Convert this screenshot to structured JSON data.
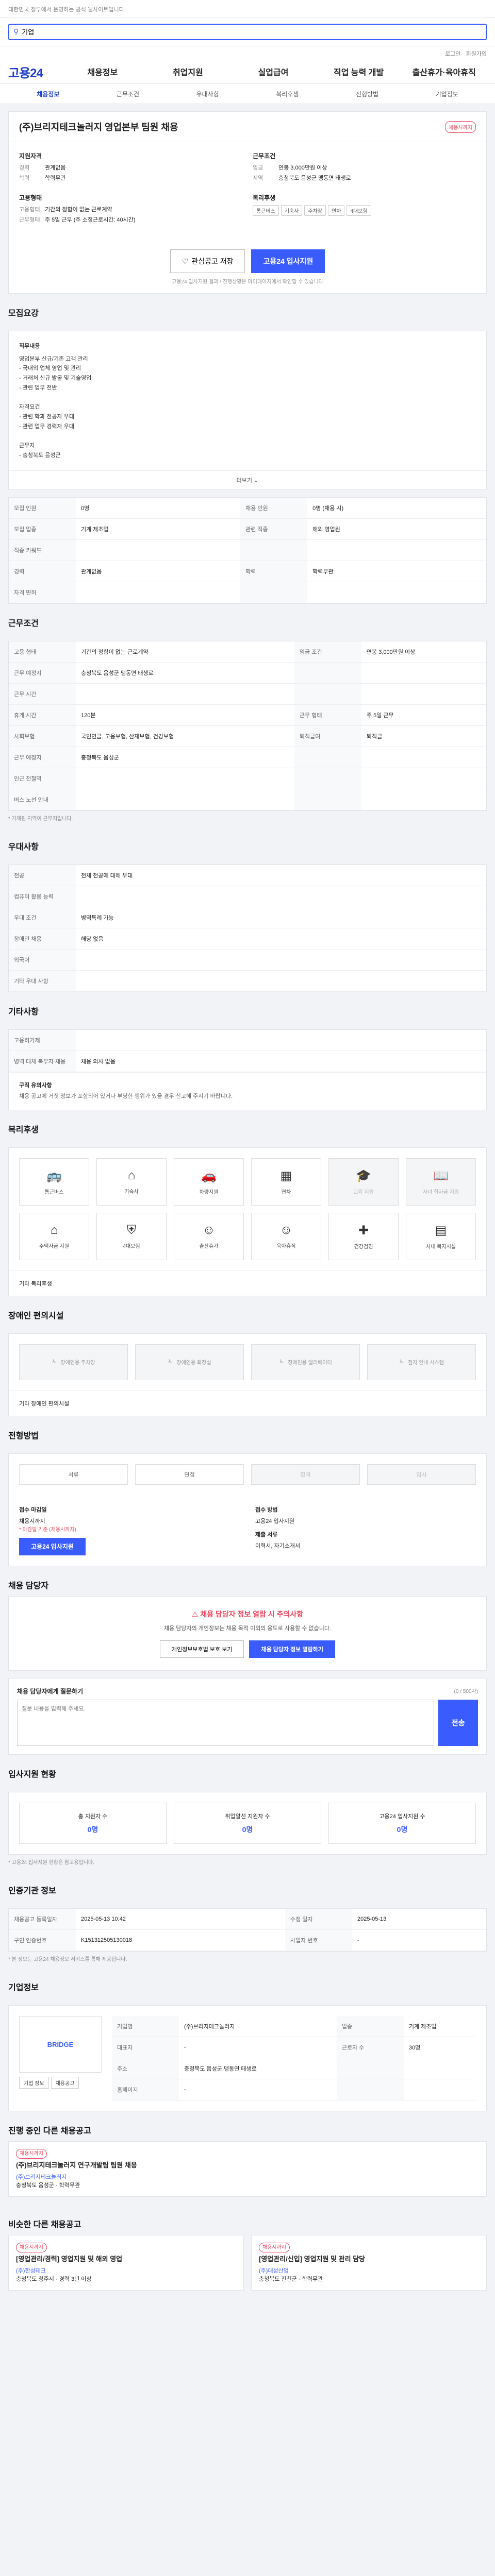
{
  "topbar": {
    "notice": "대한민국 정부에서 운영하는 공식 웹사이트입니다"
  },
  "search": {
    "value": "기업",
    "placeholder": ""
  },
  "header": {
    "logo": "고용24",
    "links": [
      "로그인",
      "회원가입"
    ],
    "gnb": [
      "채용정보",
      "취업지원",
      "실업급여",
      "직업 능력 개발",
      "출산휴가·육아휴직"
    ]
  },
  "lnb": {
    "items": [
      "채용정보",
      "근무조건",
      "우대사항",
      "복리후생",
      "전형방법",
      "기업정보"
    ]
  },
  "job": {
    "title": "(주)브리지테크놀러지 영업본부 팀원 채용",
    "badge": "채용시까지",
    "recruit_label": "지원자격",
    "career_k": "경력",
    "career_v": "관계없음",
    "edu_k": "학력",
    "edu_v": "학력무관",
    "condition_label": "근무조건",
    "salary_k": "임금",
    "salary_v": "연봉 3,000만원 이상",
    "region_k": "지역",
    "region_v": "충청북도 음성군 맹동면 태생로",
    "emp_label": "고용형태",
    "emptype_k": "고용형태",
    "emptype_v": "기간의 정함이 없는 근로계약",
    "worktime_k": "근무형태",
    "worktime_v": "주 5일 근무 (주 소정근로시간: 40시간)",
    "welfare_label": "복리후생",
    "welfare_chips": [
      "통근버스",
      "기숙사",
      "주차장",
      "연차",
      "4대보험"
    ],
    "scrap_label": "관심공고 저장",
    "apply_label": "고용24 입사지원",
    "notice": "고용24 입사지원 결과 / 진행상황은 마이페이지에서 확인할 수 있습니다"
  },
  "sections": {
    "recruit": "모집요강",
    "condition": "근무조건",
    "preference": "우대사항",
    "other": "기타사항",
    "welfare": "복리후생",
    "disabled": "장애인 편의시설",
    "process": "전형방법",
    "manager": "채용 담당자",
    "status": "입사지원 현황",
    "info": "인증기관 정보",
    "company": "기업정보",
    "related": "진행 중인 다른 채용공고",
    "similar": "비슷한 다른 채용공고"
  },
  "recruit": {
    "body_title": "직무내용",
    "lines": [
      "영업본부 신규/기존 고객 관리",
      "- 국내외 업체 영업 및 관리",
      "- 거래처 신규 발굴 및 기술영업",
      "- 관련 업무 전반",
      "",
      "자격요건",
      "- 관련 학과 전공자 우대",
      "- 관련 업무 경력자 우대",
      "",
      "근무지",
      "- 충청북도 음성군"
    ],
    "more": "더보기",
    "rows": [
      [
        "모집 인원",
        "0명",
        "채용 인원",
        "0명 (채용 시)"
      ],
      [
        "모집 업종",
        "기계 제조업",
        "관련 직종",
        "해외 영업원"
      ],
      [
        "직종 키워드",
        "",
        "",
        ""
      ],
      [
        "경력",
        "관계없음",
        "학력",
        "학력무관"
      ],
      [
        "자격 면허",
        "",
        "",
        ""
      ]
    ],
    "tags": [
      "전공",
      "외국어 관련"
    ]
  },
  "condition": {
    "rows": [
      [
        "고용 형태",
        "기간의 정함이 없는 근로계약",
        "임금 조건",
        "연봉 3,000만원 이상"
      ],
      [
        "근무 예정지",
        "충청북도 음성군 맹동면 태생로",
        "",
        ""
      ],
      [
        "근무 시간",
        "",
        "",
        ""
      ],
      [
        "휴게 시간",
        "120분",
        "근무 형태",
        "주 5일 근무"
      ],
      [
        "사회보험",
        "국민연금, 고용보험, 산재보험, 건강보험",
        "퇴직급여",
        "퇴직금"
      ],
      [
        "근무 예정지",
        "충청북도 음성군",
        "",
        ""
      ],
      [
        "인근 전철역",
        "",
        "",
        ""
      ],
      [
        "버스 노선 안내",
        "",
        "",
        ""
      ]
    ],
    "map_btn": "지도 보기",
    "note": "* 기재된 지역이 근무지입니다."
  },
  "preference": {
    "rows": [
      [
        "전공",
        "전체 전공에 대해 우대"
      ],
      [
        "컴퓨터 활용 능력",
        ""
      ],
      [
        "우대 조건",
        "병역특례 가능"
      ],
      [
        "장애인 채용",
        "해당 없음"
      ],
      [
        "외국어",
        ""
      ],
      [
        "기타 우대 사항",
        ""
      ]
    ]
  },
  "other": {
    "rows": [
      [
        "고용허가제",
        ""
      ],
      [
        "병역 대체 복무자 채용",
        "채용 의사 없음"
      ]
    ],
    "notice_title": "구직 유의사항",
    "notice": "채용 공고에 거짓 정보가 포함되어 있거나 부당한 행위가 있을 경우 신고해 주시기 바랍니다."
  },
  "welfare_items": [
    {
      "name": "통근버스",
      "icon": "bus-icon",
      "on": true
    },
    {
      "name": "기숙사",
      "icon": "home-icon",
      "on": true
    },
    {
      "name": "차량지원",
      "icon": "car-icon",
      "on": true
    },
    {
      "name": "연차",
      "icon": "calendar-icon",
      "on": true
    },
    {
      "name": "교육 지원",
      "icon": "cap-icon",
      "on": false
    },
    {
      "name": "자녀 학자금 지원",
      "icon": "book-icon",
      "on": false
    },
    {
      "name": "주택자금 지원",
      "icon": "house-icon",
      "on": true
    },
    {
      "name": "4대보험",
      "icon": "shield-icon",
      "on": true
    },
    {
      "name": "출산휴가",
      "icon": "baby-icon",
      "on": true
    },
    {
      "name": "육아휴직",
      "icon": "child-icon",
      "on": true
    },
    {
      "name": "건강검진",
      "icon": "health-icon",
      "on": true
    },
    {
      "name": "사내 복지시설",
      "icon": "building-icon",
      "on": true
    }
  ],
  "welfare_extra_label": "기타 복리후생",
  "disabled_items": [
    "장애인용 주차장",
    "장애인용 화장실",
    "장애인용 엘리베이터",
    "점자 안내 시스템"
  ],
  "disabled_extra": "기타 장애인 편의시설",
  "process": {
    "steps": [
      "서류",
      "면접",
      "합격",
      "입사"
    ],
    "apply_k": "접수 마감일",
    "apply_v": "채용시까지",
    "apply_method_k": "접수 방법",
    "apply_method_v": "고용24 입사지원",
    "doc_k": "제출 서류",
    "doc_v": "이력서, 자기소개서",
    "apply_btn": "고용24 입사지원",
    "red": "* 마감일 기준 (채용시까지)"
  },
  "manager": {
    "alert_title": "채용 담당자 정보 열람 시 주의사항",
    "alert_text": "채용 담당자의 개인정보는 채용 목적 이외의 용도로 사용할 수 없습니다.",
    "btn1": "개인정보보호법 보호 보기",
    "btn2": "채용 담당자 정보 열람하기",
    "qa_label": "채용 담당자에게 질문하기",
    "qa_count": "(0 / 500자)",
    "qa_placeholder": "질문 내용을 입력해 주세요.",
    "qa_btn": "전송"
  },
  "status": {
    "cards": [
      {
        "label": "총 지원자 수",
        "value": "0명"
      },
      {
        "label": "취업알선 지원자 수",
        "value": "0명"
      },
      {
        "label": "고용24 입사지원 수",
        "value": "0명"
      }
    ],
    "note": "* 고용24 입사지원 현황은 참고용입니다."
  },
  "info": {
    "rows": [
      [
        "채용공고 등록일자",
        "2025-05-13 10:42",
        "수정 일자",
        "2025-05-13"
      ],
      [
        "구인 인증번호",
        "K151312505130018",
        "사업자 번호",
        "-"
      ]
    ],
    "note": "* 본 정보는 고용24 채용정보 서비스를 통해 제공됩니다."
  },
  "company": {
    "name": "(주)브리지테크놀러지",
    "logo_text": "BRIDGE",
    "rows": [
      [
        "기업명",
        "(주)브리지테크놀러지",
        "업종",
        "기계 제조업"
      ],
      [
        "대표자",
        "-",
        "근로자 수",
        "30명"
      ],
      [
        "주소",
        "충청북도 음성군 맹동면 태생로",
        "",
        ""
      ],
      [
        "홈페이지",
        "-",
        "",
        ""
      ]
    ],
    "btn1": "기업 정보",
    "btn2": "채용공고",
    "btn3": "관심기업 등록"
  },
  "related": [
    {
      "badge": "채용시까지",
      "title": "(주)브리지테크놀러지 연구개발팀 팀원 채용",
      "company": "(주)브리지테크놀러지",
      "meta": "충청북도 음성군 · 학력무관"
    }
  ],
  "similar": [
    {
      "badge": "채용시까지",
      "title": "[영업관리/경력] 영업지원 및 해외 영업",
      "company": "(주)한성테크",
      "meta": "충청북도 청주시 · 경력 3년 이상"
    },
    {
      "badge": "채용시까지",
      "title": "[영업관리/신입] 영업지원 및 관리 담당",
      "company": "(주)대성산업",
      "meta": "충청북도 진천군 · 학력무관"
    }
  ],
  "colors": {
    "primary": "#3a5cff",
    "brand": "#1e3ec8",
    "alert": "#e8445b"
  }
}
